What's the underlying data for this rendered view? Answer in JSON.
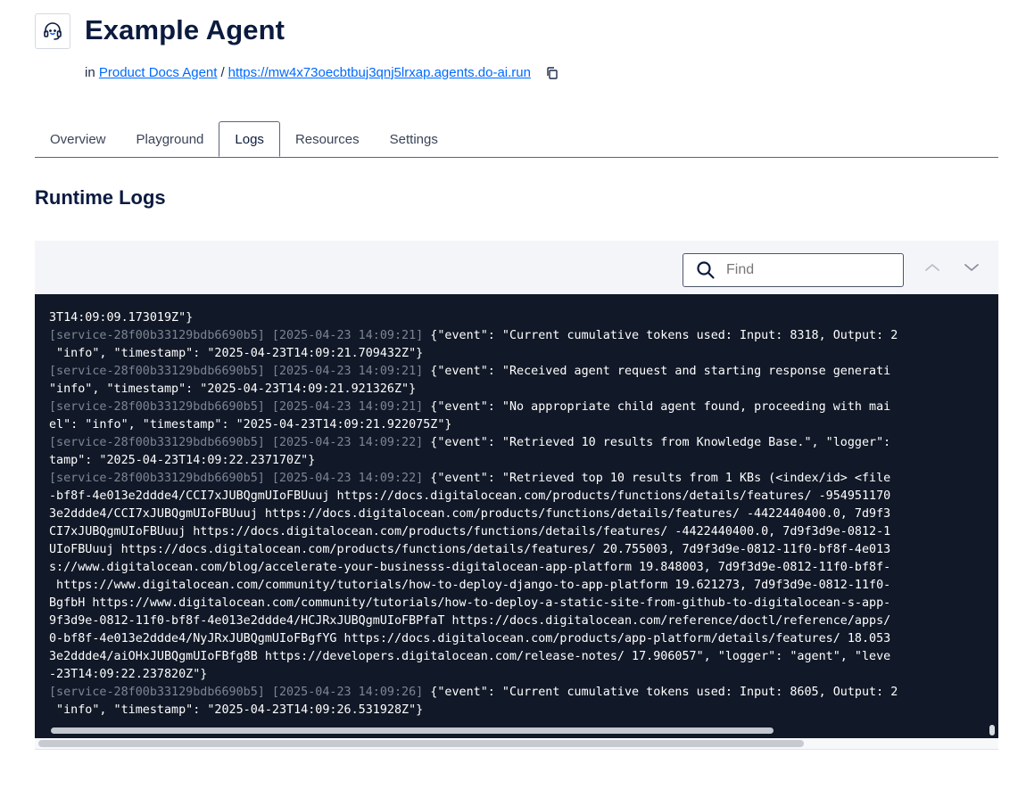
{
  "header": {
    "title": "Example Agent",
    "breadcrumb_prefix": "in",
    "project_link": "Product Docs Agent",
    "separator": "/",
    "endpoint_link": "https://mw4x73oecbtbuj3qnj5lrxap.agents.do-ai.run",
    "icons": {
      "agent": "headset-agent-icon",
      "copy": "copy-icon"
    }
  },
  "tabs": [
    {
      "label": "Overview",
      "active": false
    },
    {
      "label": "Playground",
      "active": false
    },
    {
      "label": "Logs",
      "active": true
    },
    {
      "label": "Resources",
      "active": false
    },
    {
      "label": "Settings",
      "active": false
    }
  ],
  "section": {
    "title": "Runtime Logs"
  },
  "find": {
    "placeholder": "Find",
    "value": ""
  },
  "colors": {
    "accent": "#0069ff",
    "terminal_bg": "#111827",
    "toolbar_bg": "#f3f5f9"
  },
  "logs": [
    {
      "meta": "",
      "text": "3T14:09:09.173019Z\"}"
    },
    {
      "meta": "[service-28f00b33129bdb6690b5] [2025-04-23 14:09:21]",
      "text": " {\"event\": \"Current cumulative tokens used: Input: 8318, Output: 2"
    },
    {
      "meta": "",
      "text": " \"info\", \"timestamp\": \"2025-04-23T14:09:21.709432Z\"}"
    },
    {
      "meta": "[service-28f00b33129bdb6690b5] [2025-04-23 14:09:21]",
      "text": " {\"event\": \"Received agent request and starting response generati"
    },
    {
      "meta": "",
      "text": "\"info\", \"timestamp\": \"2025-04-23T14:09:21.921326Z\"}"
    },
    {
      "meta": "[service-28f00b33129bdb6690b5] [2025-04-23 14:09:21]",
      "text": " {\"event\": \"No appropriate child agent found, proceeding with mai"
    },
    {
      "meta": "",
      "text": "el\": \"info\", \"timestamp\": \"2025-04-23T14:09:21.922075Z\"}"
    },
    {
      "meta": "[service-28f00b33129bdb6690b5] [2025-04-23 14:09:22]",
      "text": " {\"event\": \"Retrieved 10 results from Knowledge Base.\", \"logger\":"
    },
    {
      "meta": "",
      "text": "tamp\": \"2025-04-23T14:09:22.237170Z\"}"
    },
    {
      "meta": "[service-28f00b33129bdb6690b5] [2025-04-23 14:09:22]",
      "text": " {\"event\": \"Retrieved top 10 results from 1 KBs (<index/id> <file"
    },
    {
      "meta": "",
      "text": "-bf8f-4e013e2ddde4/CCI7xJUBQgmUIoFBUuuj https://docs.digitalocean.com/products/functions/details/features/ -954951170"
    },
    {
      "meta": "",
      "text": "3e2ddde4/CCI7xJUBQgmUIoFBUuuj https://docs.digitalocean.com/products/functions/details/features/ -4422440400.0, 7d9f3"
    },
    {
      "meta": "",
      "text": "CI7xJUBQgmUIoFBUuuj https://docs.digitalocean.com/products/functions/details/features/ -4422440400.0, 7d9f3d9e-0812-1"
    },
    {
      "meta": "",
      "text": "UIoFBUuuj https://docs.digitalocean.com/products/functions/details/features/ 20.755003, 7d9f3d9e-0812-11f0-bf8f-4e013"
    },
    {
      "meta": "",
      "text": "s://www.digitalocean.com/blog/accelerate-your-businesss-digitalocean-app-platform 19.848003, 7d9f3d9e-0812-11f0-bf8f-"
    },
    {
      "meta": "",
      "text": " https://www.digitalocean.com/community/tutorials/how-to-deploy-django-to-app-platform 19.621273, 7d9f3d9e-0812-11f0-"
    },
    {
      "meta": "",
      "text": "BgfbH https://www.digitalocean.com/community/tutorials/how-to-deploy-a-static-site-from-github-to-digitalocean-s-app-"
    },
    {
      "meta": "",
      "text": "9f3d9e-0812-11f0-bf8f-4e013e2ddde4/HCJRxJUBQgmUIoFBPfaT https://docs.digitalocean.com/reference/doctl/reference/apps/"
    },
    {
      "meta": "",
      "text": "0-bf8f-4e013e2ddde4/NyJRxJUBQgmUIoFBgfYG https://docs.digitalocean.com/products/app-platform/details/features/ 18.053"
    },
    {
      "meta": "",
      "text": "3e2ddde4/aiOHxJUBQgmUIoFBfg8B https://developers.digitalocean.com/release-notes/ 17.906057\", \"logger\": \"agent\", \"leve"
    },
    {
      "meta": "",
      "text": "-23T14:09:22.237820Z\"}"
    },
    {
      "meta": "[service-28f00b33129bdb6690b5] [2025-04-23 14:09:26]",
      "text": " {\"event\": \"Current cumulative tokens used: Input: 8605, Output: 2"
    },
    {
      "meta": "",
      "text": " \"info\", \"timestamp\": \"2025-04-23T14:09:26.531928Z\"}"
    }
  ]
}
